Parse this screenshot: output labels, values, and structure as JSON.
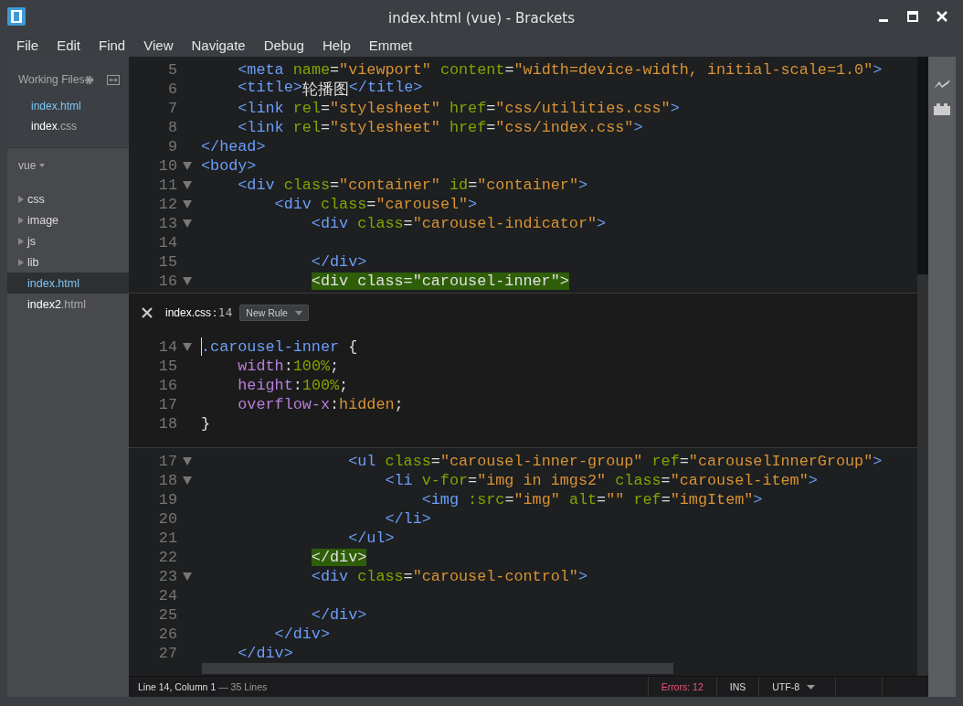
{
  "window": {
    "title": "index.html (vue) - Brackets"
  },
  "menu": [
    "File",
    "Edit",
    "Find",
    "View",
    "Navigate",
    "Debug",
    "Help",
    "Emmet"
  ],
  "sidebar": {
    "working_files_title": "Working Files",
    "working_files": [
      {
        "name": "index",
        "ext": ".html",
        "selected": true
      },
      {
        "name": "index",
        "ext": ".css",
        "selected": false
      }
    ],
    "project": "vue",
    "tree": [
      {
        "kind": "folder",
        "name": "css",
        "selected": false
      },
      {
        "kind": "folder",
        "name": "image",
        "selected": false
      },
      {
        "kind": "folder",
        "name": "js",
        "selected": false
      },
      {
        "kind": "folder",
        "name": "lib",
        "selected": false
      },
      {
        "kind": "file",
        "name": "index",
        "ext": ".html",
        "selected": true
      },
      {
        "kind": "file",
        "name": "index2",
        "ext": ".html",
        "selected": false
      }
    ]
  },
  "editor_top": [
    {
      "n": "5",
      "fold": false,
      "tokens": [
        {
          "kind": "tag",
          "text": "    <meta"
        },
        {
          "kind": "attr",
          "text": " name"
        },
        {
          "kind": "plain",
          "text": "="
        },
        {
          "kind": "str",
          "text": "\"viewport\""
        },
        {
          "kind": "attr",
          "text": " content"
        },
        {
          "kind": "plain",
          "text": "="
        },
        {
          "kind": "str",
          "text": "\"width=device-width, initial-scale=1.0\""
        },
        {
          "kind": "tag",
          "text": ">"
        }
      ]
    },
    {
      "n": "6",
      "fold": false,
      "tokens": [
        {
          "kind": "tag",
          "text": "    <title>"
        },
        {
          "kind": "plain",
          "text": "轮播图"
        },
        {
          "kind": "tag",
          "text": "</title>"
        }
      ]
    },
    {
      "n": "7",
      "fold": false,
      "tokens": [
        {
          "kind": "tag",
          "text": "    <link"
        },
        {
          "kind": "attr",
          "text": " rel"
        },
        {
          "kind": "plain",
          "text": "="
        },
        {
          "kind": "str",
          "text": "\"stylesheet\""
        },
        {
          "kind": "attr",
          "text": " href"
        },
        {
          "kind": "plain",
          "text": "="
        },
        {
          "kind": "str",
          "text": "\"css/utilities.css\""
        },
        {
          "kind": "tag",
          "text": ">"
        }
      ]
    },
    {
      "n": "8",
      "fold": false,
      "tokens": [
        {
          "kind": "tag",
          "text": "    <link"
        },
        {
          "kind": "attr",
          "text": " rel"
        },
        {
          "kind": "plain",
          "text": "="
        },
        {
          "kind": "str",
          "text": "\"stylesheet\""
        },
        {
          "kind": "attr",
          "text": " href"
        },
        {
          "kind": "plain",
          "text": "="
        },
        {
          "kind": "str",
          "text": "\"css/index.css\""
        },
        {
          "kind": "tag",
          "text": ">"
        }
      ]
    },
    {
      "n": "9",
      "fold": false,
      "tokens": [
        {
          "kind": "tag",
          "text": "</head>"
        }
      ]
    },
    {
      "n": "10",
      "fold": true,
      "tokens": [
        {
          "kind": "tag",
          "text": "<body>"
        }
      ]
    },
    {
      "n": "11",
      "fold": true,
      "tokens": [
        {
          "kind": "tag",
          "text": "    <div"
        },
        {
          "kind": "attr",
          "text": " class"
        },
        {
          "kind": "plain",
          "text": "="
        },
        {
          "kind": "str",
          "text": "\"container\""
        },
        {
          "kind": "attr",
          "text": " id"
        },
        {
          "kind": "plain",
          "text": "="
        },
        {
          "kind": "str",
          "text": "\"container\""
        },
        {
          "kind": "tag",
          "text": ">"
        }
      ]
    },
    {
      "n": "12",
      "fold": true,
      "tokens": [
        {
          "kind": "tag",
          "text": "        <div"
        },
        {
          "kind": "attr",
          "text": " class"
        },
        {
          "kind": "plain",
          "text": "="
        },
        {
          "kind": "str",
          "text": "\"carousel\""
        },
        {
          "kind": "tag",
          "text": ">"
        }
      ]
    },
    {
      "n": "13",
      "fold": true,
      "tokens": [
        {
          "kind": "tag",
          "text": "            <div"
        },
        {
          "kind": "attr",
          "text": " class"
        },
        {
          "kind": "plain",
          "text": "="
        },
        {
          "kind": "str",
          "text": "\"carousel-indicator\""
        },
        {
          "kind": "tag",
          "text": ">"
        }
      ]
    },
    {
      "n": "14",
      "fold": false
    },
    {
      "n": "15",
      "fold": false,
      "tokens": [
        {
          "kind": "tag",
          "text": "            </div>"
        }
      ]
    },
    {
      "n": "16",
      "fold": true,
      "tokens": [
        {
          "kind": "match",
          "text": "            <div class=\"carousel-inner\">"
        }
      ]
    }
  ],
  "inline_editor": {
    "file": "index.css",
    "sep": ":",
    "line": "14",
    "button": "New Rule",
    "lines": [
      {
        "n": "14",
        "fold": true,
        "cursor": true,
        "tokens": [
          {
            "kind": "sel",
            "text": ".carousel-inner"
          },
          {
            "kind": "plain",
            "text": " {"
          }
        ]
      },
      {
        "n": "15",
        "fold": false,
        "tokens": [
          {
            "kind": "prop",
            "text": "    width"
          },
          {
            "kind": "plain",
            "text": ":"
          },
          {
            "kind": "num",
            "text": "100%"
          },
          {
            "kind": "plain",
            "text": ";"
          }
        ]
      },
      {
        "n": "16",
        "fold": false,
        "tokens": [
          {
            "kind": "prop",
            "text": "    height"
          },
          {
            "kind": "plain",
            "text": ":"
          },
          {
            "kind": "num",
            "text": "100%"
          },
          {
            "kind": "plain",
            "text": ";"
          }
        ]
      },
      {
        "n": "17",
        "fold": false,
        "tokens": [
          {
            "kind": "prop",
            "text": "    overflow-x"
          },
          {
            "kind": "plain",
            "text": ":"
          },
          {
            "kind": "val",
            "text": "hidden"
          },
          {
            "kind": "plain",
            "text": ";"
          }
        ]
      },
      {
        "n": "18",
        "fold": false,
        "tokens": [
          {
            "kind": "plain",
            "text": "}"
          }
        ]
      }
    ]
  },
  "editor_bottom": [
    {
      "n": "17",
      "fold": true,
      "tokens": [
        {
          "kind": "tag",
          "text": "                <ul"
        },
        {
          "kind": "attr",
          "text": " class"
        },
        {
          "kind": "plain",
          "text": "="
        },
        {
          "kind": "str",
          "text": "\"carousel-inner-group\""
        },
        {
          "kind": "attr",
          "text": " ref"
        },
        {
          "kind": "plain",
          "text": "="
        },
        {
          "kind": "str",
          "text": "\"carouselInnerGroup\""
        },
        {
          "kind": "tag",
          "text": ">"
        }
      ]
    },
    {
      "n": "18",
      "fold": true,
      "tokens": [
        {
          "kind": "tag",
          "text": "                    <li"
        },
        {
          "kind": "attr",
          "text": " v-for"
        },
        {
          "kind": "plain",
          "text": "="
        },
        {
          "kind": "str",
          "text": "\"img in imgs2\""
        },
        {
          "kind": "attr",
          "text": " class"
        },
        {
          "kind": "plain",
          "text": "="
        },
        {
          "kind": "str",
          "text": "\"carousel-item\""
        },
        {
          "kind": "tag",
          "text": ">"
        }
      ]
    },
    {
      "n": "19",
      "fold": false,
      "tokens": [
        {
          "kind": "tag",
          "text": "                        <img"
        },
        {
          "kind": "attr",
          "text": " :src"
        },
        {
          "kind": "plain",
          "text": "="
        },
        {
          "kind": "str",
          "text": "\"img\""
        },
        {
          "kind": "attr",
          "text": " alt"
        },
        {
          "kind": "plain",
          "text": "="
        },
        {
          "kind": "str",
          "text": "\"\""
        },
        {
          "kind": "attr",
          "text": " ref"
        },
        {
          "kind": "plain",
          "text": "="
        },
        {
          "kind": "str",
          "text": "\"imgItem\""
        },
        {
          "kind": "tag",
          "text": ">"
        }
      ]
    },
    {
      "n": "20",
      "fold": false,
      "tokens": [
        {
          "kind": "tag",
          "text": "                    </li>"
        }
      ]
    },
    {
      "n": "21",
      "fold": false,
      "tokens": [
        {
          "kind": "tag",
          "text": "                </ul>"
        }
      ]
    },
    {
      "n": "22",
      "fold": false,
      "tokens": [
        {
          "kind": "match",
          "text": "            </div>"
        }
      ]
    },
    {
      "n": "23",
      "fold": true,
      "tokens": [
        {
          "kind": "tag",
          "text": "            <div"
        },
        {
          "kind": "attr",
          "text": " class"
        },
        {
          "kind": "plain",
          "text": "="
        },
        {
          "kind": "str",
          "text": "\"carousel-control\""
        },
        {
          "kind": "tag",
          "text": ">"
        }
      ]
    },
    {
      "n": "24",
      "fold": false
    },
    {
      "n": "25",
      "fold": false,
      "tokens": [
        {
          "kind": "tag",
          "text": "            </div>"
        }
      ]
    },
    {
      "n": "26",
      "fold": false,
      "tokens": [
        {
          "kind": "tag",
          "text": "        </div>"
        }
      ]
    },
    {
      "n": "27",
      "fold": false,
      "tokens": [
        {
          "kind": "tag",
          "text": "    </div>"
        }
      ]
    }
  ],
  "status_bar": {
    "position": "Line 14, Column 1",
    "lines": " — 35 Lines",
    "errors": "Errors: 12",
    "mode": "INS",
    "encoding": "UTF-8"
  }
}
